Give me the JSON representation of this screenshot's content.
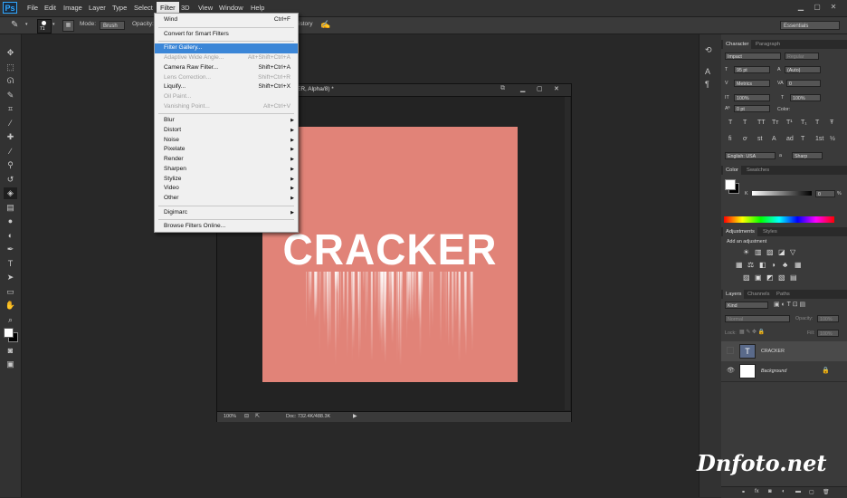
{
  "app": {
    "logo": "Ps"
  },
  "menubar": {
    "items": [
      "File",
      "Edit",
      "Image",
      "Layer",
      "Type",
      "Select",
      "Filter",
      "3D",
      "View",
      "Window",
      "Help"
    ],
    "open_item": "Filter"
  },
  "options": {
    "brush_size": "71",
    "mode_label": "Mode:",
    "mode_value": "Brush",
    "opacity_label": "Opacity:",
    "history_label": "istory",
    "workspace": "Essentials"
  },
  "filter_menu": {
    "groups": [
      [
        {
          "label": "Wind",
          "shortcut": "Ctrl+F"
        }
      ],
      [
        {
          "label": "Convert for Smart Filters"
        }
      ],
      [
        {
          "label": "Filter Gallery...",
          "highlighted": true
        },
        {
          "label": "Adaptive Wide Angle...",
          "shortcut": "Alt+Shift+Ctrl+A",
          "disabled": true
        },
        {
          "label": "Camera Raw Filter...",
          "shortcut": "Shift+Ctrl+A"
        },
        {
          "label": "Lens Correction...",
          "shortcut": "Shift+Ctrl+R",
          "disabled": true
        },
        {
          "label": "Liquify...",
          "shortcut": "Shift+Ctrl+X"
        },
        {
          "label": "Oil Paint...",
          "disabled": true
        },
        {
          "label": "Vanishing Point...",
          "shortcut": "Alt+Ctrl+V",
          "disabled": true
        }
      ],
      [
        {
          "label": "Blur",
          "submenu": true
        },
        {
          "label": "Distort",
          "submenu": true
        },
        {
          "label": "Noise",
          "submenu": true
        },
        {
          "label": "Pixelate",
          "submenu": true
        },
        {
          "label": "Render",
          "submenu": true
        },
        {
          "label": "Sharpen",
          "submenu": true
        },
        {
          "label": "Stylize",
          "submenu": true
        },
        {
          "label": "Video",
          "submenu": true
        },
        {
          "label": "Other",
          "submenu": true
        }
      ],
      [
        {
          "label": "Digimarc",
          "submenu": true
        }
      ],
      [
        {
          "label": "Browse Filters Online..."
        }
      ]
    ]
  },
  "document": {
    "title_fragment": "ER, Alpha/8) *",
    "zoom": "100%",
    "doc_info": "Doc: 732.4K/488.3K",
    "canvas_text": "CRACKER"
  },
  "character_panel": {
    "tabs": [
      "Character",
      "Paragraph"
    ],
    "font_family": "Impact",
    "font_style": "Regular",
    "font_size": "95 pt",
    "leading": "(Auto)",
    "kerning": "Metrics",
    "tracking": "0",
    "vscale": "100%",
    "hscale": "100%",
    "baseline": "0 pt",
    "color_label": "Color:",
    "language": "English: USA",
    "aa_label": "a",
    "aa_value": "Sharp",
    "style_buttons": [
      "T",
      "T",
      "TT",
      "Tт",
      "T¹",
      "T₁",
      "T",
      "Ŧ"
    ],
    "opentype_buttons": [
      "fi",
      "ơ",
      "st",
      "A",
      "ad",
      "T",
      "1st",
      "½"
    ]
  },
  "color_panel": {
    "tabs": [
      "Color",
      "Swatches"
    ],
    "channel": "K",
    "value": "0",
    "unit": "%"
  },
  "adjustments_panel": {
    "tabs": [
      "Adjustments",
      "Styles"
    ],
    "heading": "Add an adjustment"
  },
  "layers_panel": {
    "tabs": [
      "Layers",
      "Channels",
      "Paths"
    ],
    "filter_kind": "Kind",
    "blend_mode": "Normal",
    "opacity_label": "Opacity:",
    "opacity": "100%",
    "lock_label": "Lock:",
    "fill_label": "Fill:",
    "fill": "100%",
    "layers": [
      {
        "name": "CRACKER",
        "type": "text",
        "visible": false,
        "selected": true
      },
      {
        "name": "Background",
        "type": "image",
        "visible": true,
        "selected": false,
        "locked": true
      }
    ],
    "footer_icons": [
      "link-icon",
      "fx-icon",
      "mask-icon",
      "adjustment-icon",
      "group-icon",
      "new-layer-icon",
      "trash-icon"
    ]
  },
  "watermark": "Dnfoto.net",
  "colors": {
    "canvas_bg": "#e18378",
    "menu_highlight": "#3b86d7",
    "text_color": "#ffffff"
  }
}
